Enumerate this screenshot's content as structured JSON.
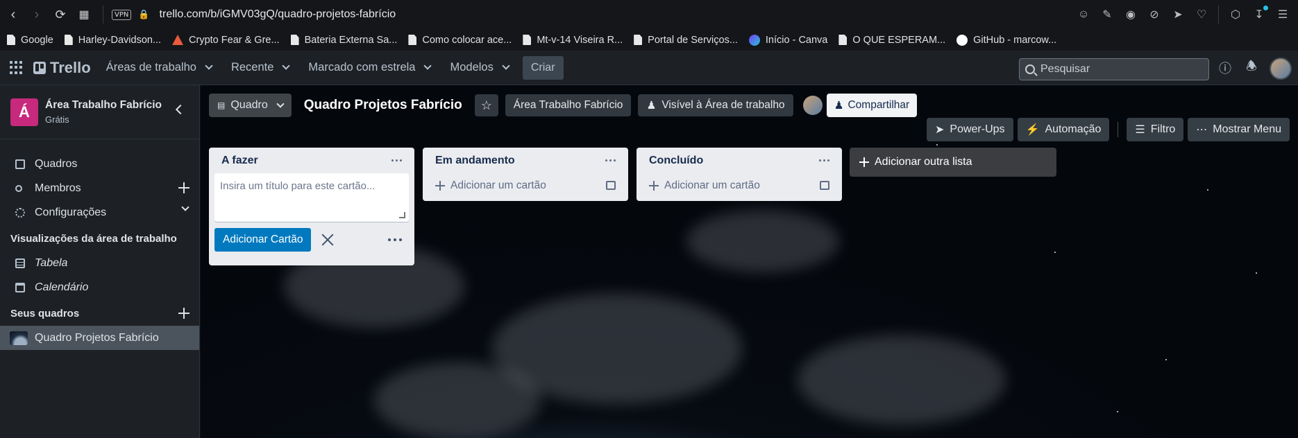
{
  "browser": {
    "url": "trello.com/b/iGMV03gQ/quadro-projetos-fabrício",
    "vpn_label": "VPN"
  },
  "bookmarks": [
    {
      "label": "Google"
    },
    {
      "label": "Harley-Davidson..."
    },
    {
      "label": "Crypto Fear & Gre..."
    },
    {
      "label": "Bateria Externa Sa..."
    },
    {
      "label": "Como colocar ace..."
    },
    {
      "label": "Mt-v-14 Viseira R..."
    },
    {
      "label": "Portal de Serviços..."
    },
    {
      "label": "Início - Canva"
    },
    {
      "label": "O QUE ESPERAM..."
    },
    {
      "label": "GitHub - marcow..."
    }
  ],
  "header": {
    "logo": "Trello",
    "menus": [
      "Áreas de trabalho",
      "Recente",
      "Marcado com estrela",
      "Modelos"
    ],
    "create": "Criar",
    "search_placeholder": "Pesquisar"
  },
  "sidebar": {
    "workspace_initial": "Á",
    "workspace_name": "Área Trabalho Fabrício",
    "workspace_plan": "Grátis",
    "items": [
      "Quadros",
      "Membros",
      "Configurações"
    ],
    "views_title": "Visualizações da área de trabalho",
    "views": [
      "Tabela",
      "Calendário"
    ],
    "boards_title": "Seus quadros",
    "boards": [
      "Quadro Projetos Fabrício"
    ]
  },
  "board": {
    "view": "Quadro",
    "title": "Quadro Projetos Fabrício",
    "workspace": "Área Trabalho Fabrício",
    "visibility": "Visível à Área de trabalho",
    "share": "Compartilhar",
    "powerups": "Power-Ups",
    "automation": "Automação",
    "filter": "Filtro",
    "menu": "Mostrar Menu",
    "lists": [
      {
        "title": "A fazer"
      },
      {
        "title": "Em andamento"
      },
      {
        "title": "Concluído"
      }
    ],
    "add_card": "Adicionar um cartão",
    "composer_placeholder": "Insira um título para este cartão...",
    "composer_submit": "Adicionar Cartão",
    "add_list": "Adicionar outra lista"
  },
  "colors": {
    "workspace_badge": "#c7297d",
    "primary_button": "#0079bf",
    "header_bg": "#1d2125"
  }
}
